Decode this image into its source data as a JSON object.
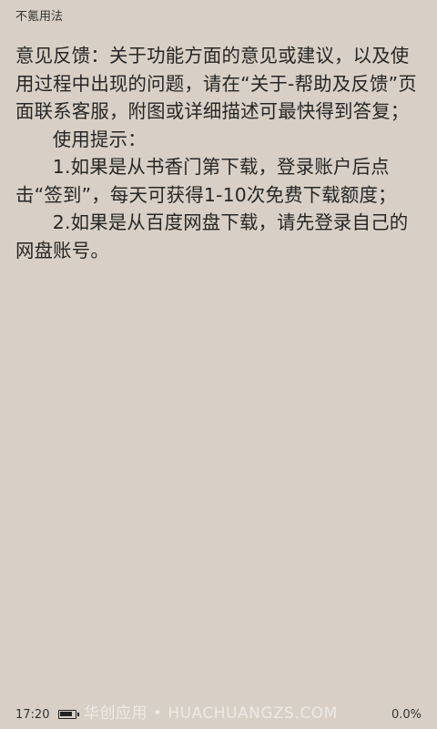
{
  "header": {
    "book_title": "不氪用法"
  },
  "content": {
    "paragraphs": [
      "意见反馈：关于功能方面的意见或建议，以及使用过程中出现的问题，请在“关于-帮助及反馈”页面联系客服，附图或详细描述可最快得到答复；",
      "使用提示：",
      "1.如果是从书香门第下载，登录账户后点击“签到”，每天可获得1-10次免费下载额度；",
      "2.如果是从百度网盘下载，请先登录自己的网盘账号。"
    ]
  },
  "footer": {
    "time": "17:20",
    "battery_level": 0.9,
    "watermark": "华创应用 • HUACHUANGZS.COM",
    "progress": "0.0%"
  }
}
